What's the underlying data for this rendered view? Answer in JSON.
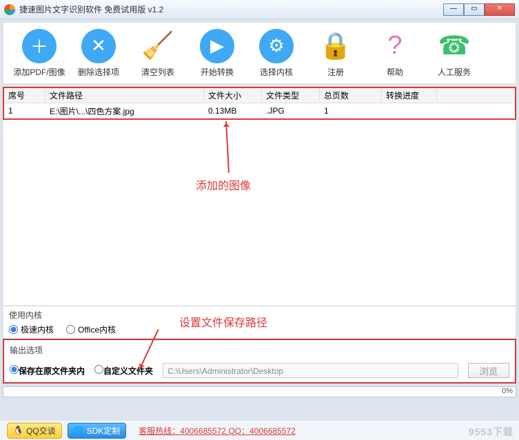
{
  "window": {
    "title": "捷速图片文字识别软件 免费试用版 v1.2"
  },
  "toolbar": [
    {
      "label": "添加PDF/图像",
      "icon": "plus-icon",
      "bg": "#3fa9f5"
    },
    {
      "label": "删除选择项",
      "icon": "x-icon",
      "bg": "#3fa9f5"
    },
    {
      "label": "清空列表",
      "icon": "broom-icon",
      "bg": "#e6c36a"
    },
    {
      "label": "开始转换",
      "icon": "play-icon",
      "bg": "#3fa9f5"
    },
    {
      "label": "选择内核",
      "icon": "gear-icon",
      "bg": "#3fa9f5"
    },
    {
      "label": "注册",
      "icon": "lock-icon",
      "bg": "#f5a623"
    },
    {
      "label": "帮助",
      "icon": "help-icon",
      "bg": "#e07ab0"
    },
    {
      "label": "人工服务",
      "icon": "phone-icon",
      "bg": "#3bbf6d"
    }
  ],
  "table": {
    "headers": [
      "席号",
      "文件路径",
      "文件大小",
      "文件类型",
      "总页数",
      "转换进度"
    ],
    "rows": [
      {
        "seq": "1",
        "path": "E:\\图片\\...\\四色方案.jpg",
        "size": "0.13MB",
        "type": ".JPG",
        "pages": "1",
        "progress": ""
      }
    ]
  },
  "annotations": {
    "annot1": "添加的图像",
    "annot2": "设置文件保存路径"
  },
  "kernel": {
    "title": "使用内核",
    "opt1": "极速内核",
    "opt2": "Office内核"
  },
  "output": {
    "title": "输出选项",
    "opt1": "保存在原文件夹内",
    "opt2": "自定义文件夹",
    "path": "C:\\Users\\Administrator\\Desktop",
    "browse": "浏览"
  },
  "progress": {
    "pct": "0%"
  },
  "footer": {
    "qq": "QQ交谈",
    "sdk": "SDK定制",
    "hotline": "客服热线：4006685572 QQ：4006685572",
    "site": "9553下载"
  }
}
